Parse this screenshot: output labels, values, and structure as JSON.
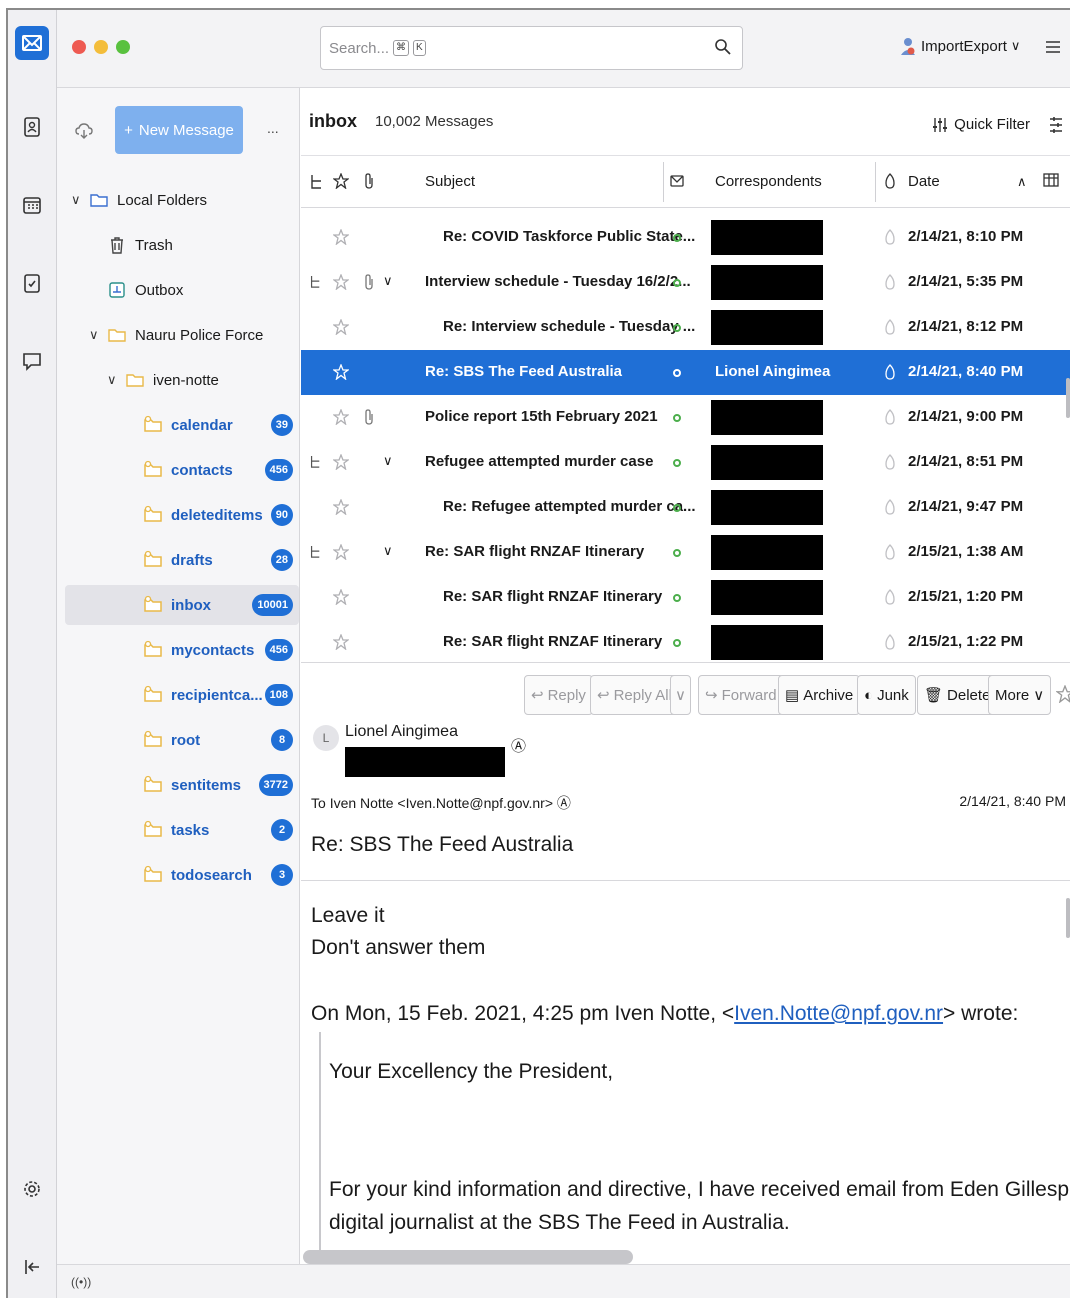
{
  "window": {
    "search": {
      "placeholder": "Search...",
      "key1": "⌘",
      "key2": "K"
    },
    "account_label": "ImportExport"
  },
  "folder_pane": {
    "new_message_label": "New Message",
    "more": "...",
    "local_folders": "Local Folders",
    "trash": "Trash",
    "outbox": "Outbox",
    "account": "Nauru Police Force",
    "mailbox": "iven-notte",
    "subfolders": [
      {
        "name": "calendar",
        "count": "39"
      },
      {
        "name": "contacts",
        "count": "456"
      },
      {
        "name": "deleteditems",
        "count": "90"
      },
      {
        "name": "drafts",
        "count": "28"
      },
      {
        "name": "inbox",
        "count": "10001"
      },
      {
        "name": "mycontacts",
        "count": "456"
      },
      {
        "name": "recipientca...",
        "count": "108"
      },
      {
        "name": "root",
        "count": "8"
      },
      {
        "name": "sentitems",
        "count": "3772"
      },
      {
        "name": "tasks",
        "count": "2"
      },
      {
        "name": "todosearch",
        "count": "3"
      }
    ]
  },
  "message_list": {
    "folder": "inbox",
    "count_label": "10,002 Messages",
    "quick_filter": "Quick Filter",
    "columns": {
      "subject": "Subject",
      "correspondents": "Correspondents",
      "date": "Date"
    },
    "rows": [
      {
        "subject": "Re: COVID Taskforce Public State...",
        "date": "2/14/21, 8:10 PM"
      },
      {
        "subject": "Interview schedule - Tuesday 16/2/2...",
        "date": "2/14/21, 5:35 PM"
      },
      {
        "subject": "Re: Interview schedule - Tuesday ...",
        "date": "2/14/21, 8:12 PM"
      },
      {
        "subject": "Re: SBS The Feed Australia",
        "correspondent": "Lionel Aingimea",
        "date": "2/14/21, 8:40 PM"
      },
      {
        "subject": "Police report 15th February 2021",
        "date": "2/14/21, 9:00 PM"
      },
      {
        "subject": "Refugee attempted murder case",
        "date": "2/14/21, 8:51 PM"
      },
      {
        "subject": "Re: Refugee attempted murder ca...",
        "date": "2/14/21, 9:47 PM"
      },
      {
        "subject": "Re: SAR flight RNZAF Itinerary",
        "date": "2/15/21, 1:38 AM"
      },
      {
        "subject": "Re: SAR flight RNZAF Itinerary",
        "date": "2/15/21, 1:20 PM"
      },
      {
        "subject": "Re: SAR flight RNZAF Itinerary",
        "date": "2/15/21, 1:22 PM"
      }
    ]
  },
  "message": {
    "actions": {
      "reply": "Reply",
      "reply_all": "Reply All",
      "forward": "Forward",
      "archive": "Archive",
      "junk": "Junk",
      "delete": "Delete",
      "more": "More"
    },
    "avatar_initial": "L",
    "from_name": "Lionel Aingimea",
    "to_label": "To",
    "to_address": "Iven Notte <Iven.Notte@npf.gov.nr>",
    "date": "2/14/21, 8:40 PM",
    "subject": "Re: SBS The Feed Australia",
    "body": {
      "line1": "Leave it",
      "line2": "Don't answer them",
      "attrib_pre": "On Mon, 15 Feb. 2021, 4:25 pm Iven Notte, <",
      "attrib_link": "Iven.Notte@npf.gov.nr",
      "attrib_post": "> wrote:",
      "quote1": "Your Excellency the President,",
      "quote2": "For your kind information and directive, I have received email from Eden Gillespie from",
      "quote3": "digital journalist at the SBS The Feed in Australia."
    }
  },
  "colors": {
    "accent": "#1f6fd6",
    "unread_dot": "#4cae4c",
    "folder_icon": "#e9b949"
  }
}
